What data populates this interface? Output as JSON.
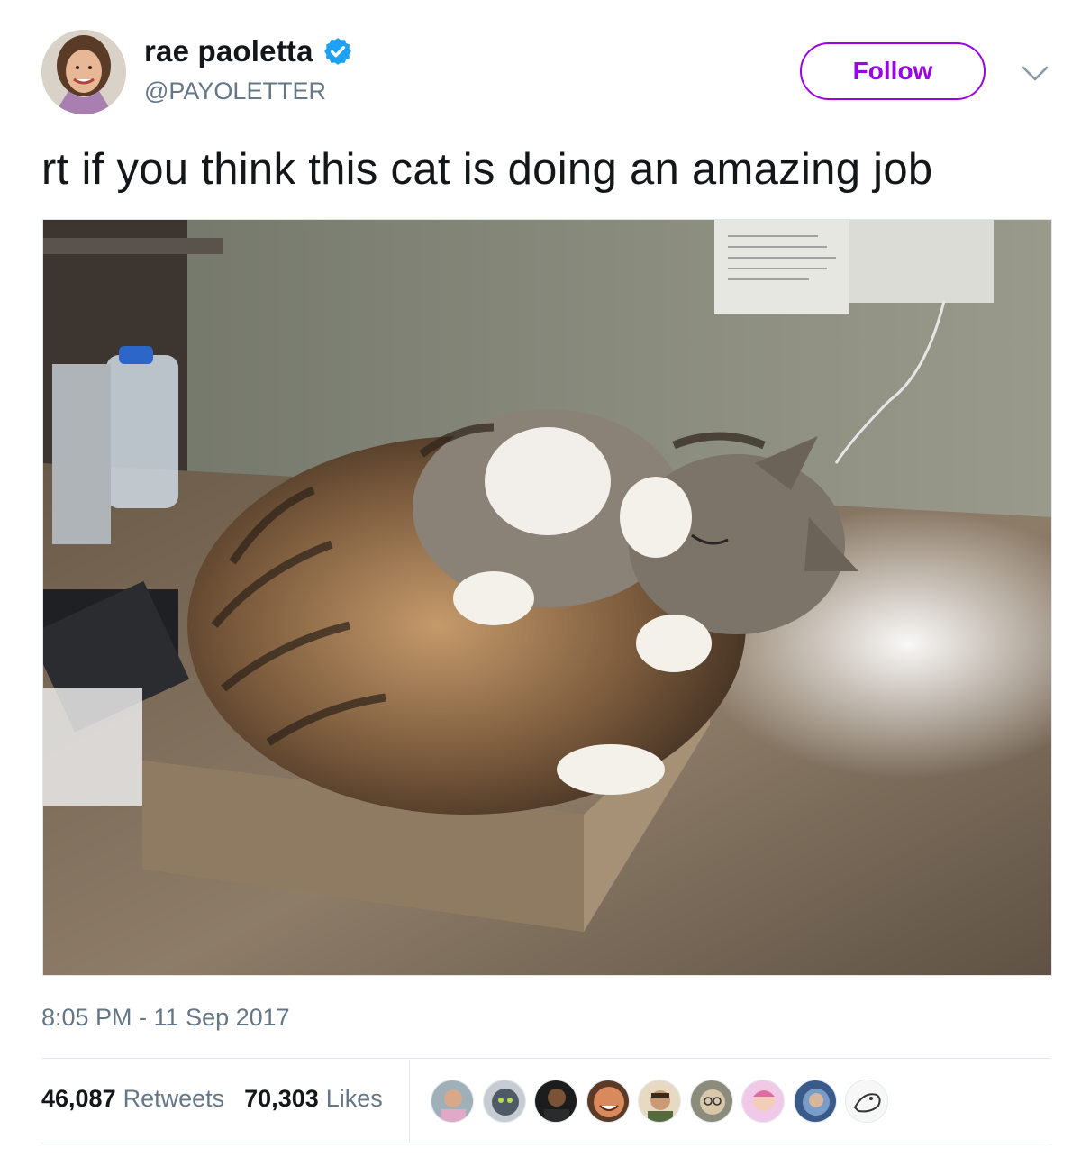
{
  "header": {
    "display_name": "rae paoletta",
    "handle": "@PAYOLETTER",
    "follow_label": "Follow",
    "verified": true
  },
  "tweet": {
    "text": "rt if you think this cat is doing an amazing job",
    "timestamp": "8:05 PM - 11 Sep 2017"
  },
  "stats": {
    "retweets_count": "46,087",
    "retweets_label": "Retweets",
    "likes_count": "70,303",
    "likes_label": "Likes"
  },
  "likers": [
    "liker-avatar-1",
    "liker-avatar-2",
    "liker-avatar-3",
    "liker-avatar-4",
    "liker-avatar-5",
    "liker-avatar-6",
    "liker-avatar-7",
    "liker-avatar-8",
    "liker-avatar-9"
  ],
  "colors": {
    "accent": "#9b00e6",
    "verified": "#1da1f2",
    "secondary_text": "#657786",
    "primary_text": "#14171a"
  },
  "icons": {
    "verified": "verified-badge-icon",
    "more": "chevron-down-icon"
  }
}
